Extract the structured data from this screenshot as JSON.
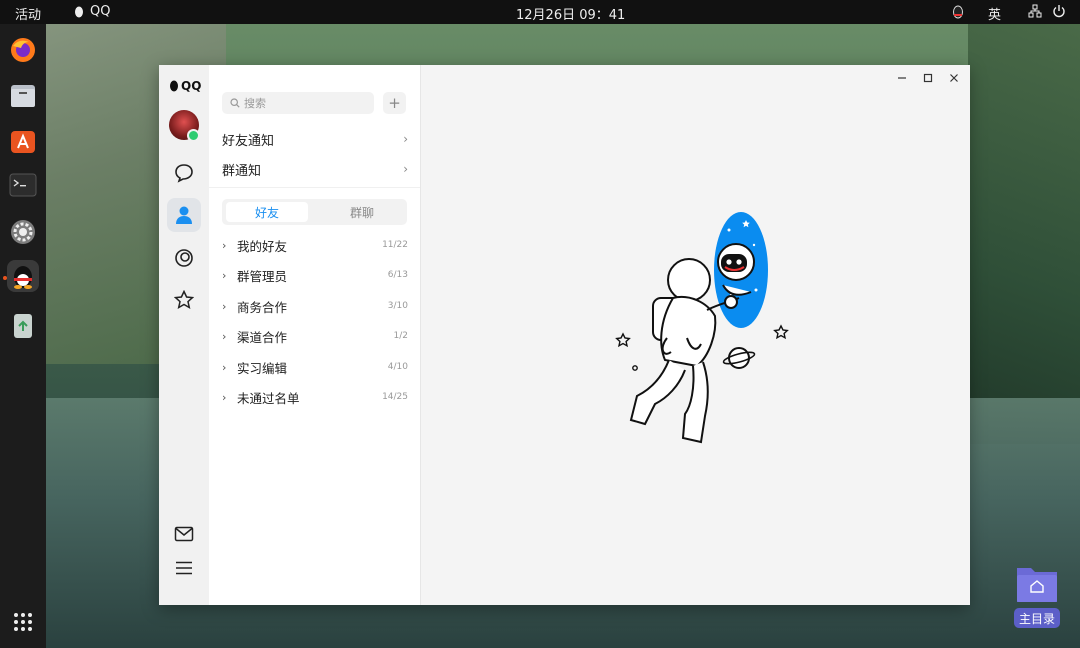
{
  "topbar": {
    "activities": "活动",
    "app_name": "QQ",
    "clock": "12月26日  09：41",
    "input_method": "英"
  },
  "dock": {
    "items": [
      "firefox-icon",
      "files-icon",
      "software-center-icon",
      "terminal-icon",
      "settings-icon",
      "qq-icon",
      "trash-icon"
    ],
    "app_grid": "app-grid-icon"
  },
  "qq": {
    "logo_text": "QQ",
    "search": {
      "placeholder": "搜索"
    },
    "add_label": "+",
    "notices": [
      {
        "label": "好友通知"
      },
      {
        "label": "群通知"
      }
    ],
    "tabs": [
      {
        "label": "好友",
        "active": true
      },
      {
        "label": "群聊",
        "active": false
      }
    ],
    "groups": [
      {
        "name": "我的好友",
        "count": "11/22"
      },
      {
        "name": "群管理员",
        "count": "6/13"
      },
      {
        "name": "商务合作",
        "count": "3/10"
      },
      {
        "name": "渠道合作",
        "count": "1/2"
      },
      {
        "name": "实习编辑",
        "count": "4/10"
      },
      {
        "name": "未通过名单",
        "count": "14/25"
      }
    ],
    "accent_color": "#1a8ff0",
    "online_color": "#2ecc71"
  },
  "desktop": {
    "folder_label": "主目录"
  }
}
